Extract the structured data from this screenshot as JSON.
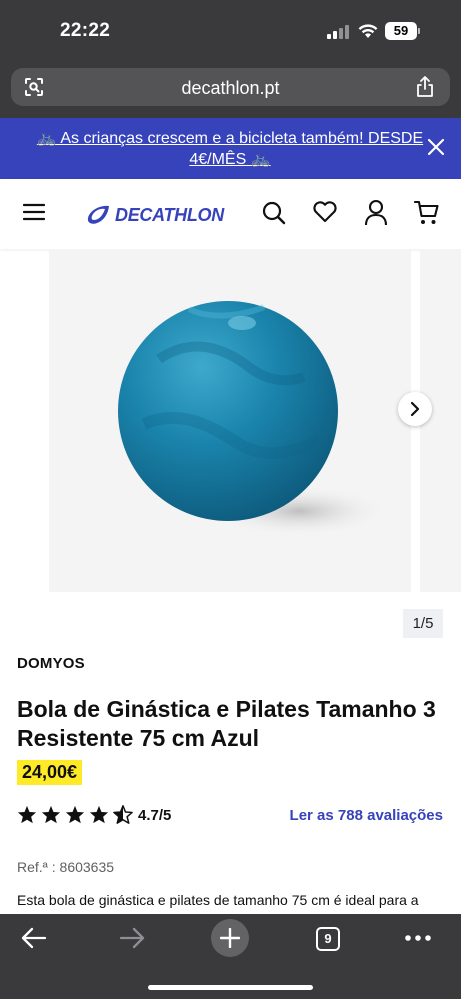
{
  "status_bar": {
    "time": "22:22",
    "battery": "59"
  },
  "browser": {
    "url": "decathlon.pt",
    "tab_count": "9"
  },
  "promo": {
    "text": "🚲 As crianças crescem e a bicicleta também! DESDE 4€/MÊS 🚲"
  },
  "header": {
    "logo": "DECATHLON"
  },
  "gallery": {
    "counter": "1/5"
  },
  "product": {
    "brand": "DOMYOS",
    "title": "Bola de Ginástica e Pilates Tamanho 3 Resistente 75 cm Azul",
    "price": "24,00€",
    "rating": "4.7/5",
    "rating_value": 4.7,
    "reviews_link": "Ler as 788 avaliações",
    "ref": "Ref.ª : 8603635",
    "description": "Esta bola de ginástica e pilates de tamanho 75 cm é ideal para a tonificação muscular e postura. Fornecida com bomba."
  },
  "colors": {
    "brand_blue": "#3643ba",
    "price_yellow": "#ffea28",
    "ball_blue": "#1a7fa6"
  }
}
